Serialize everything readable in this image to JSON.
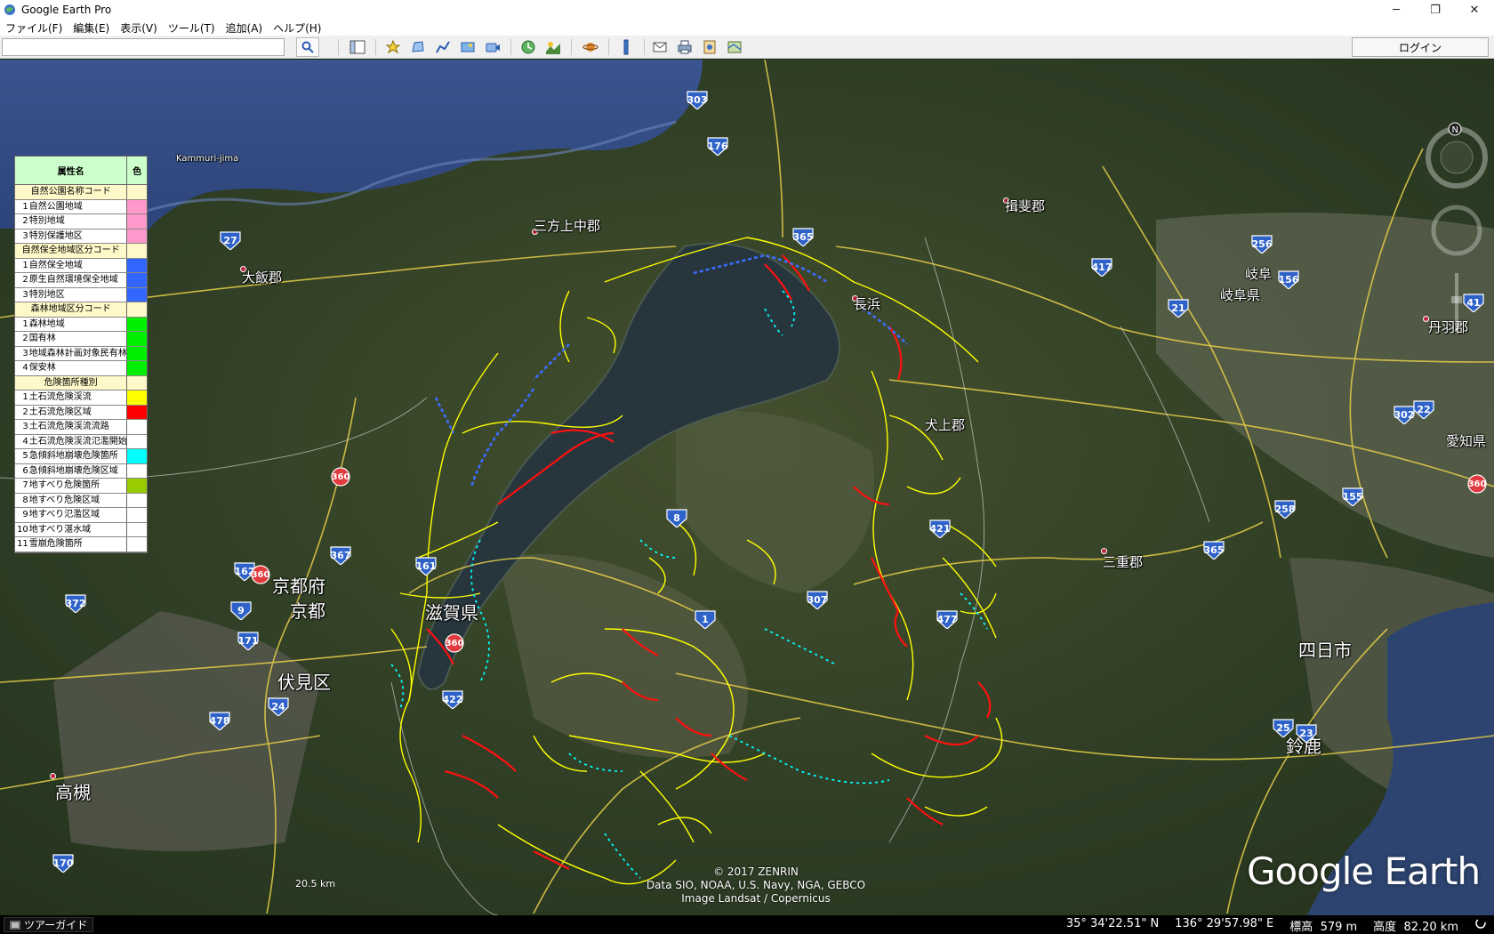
{
  "window": {
    "title": "Google Earth Pro",
    "controls": [
      "─",
      "❐",
      "✕"
    ]
  },
  "menu": [
    "ファイル(F)",
    "編集(E)",
    "表示(V)",
    "ツール(T)",
    "追加(A)",
    "ヘルプ(H)"
  ],
  "toolbar": {
    "search_value": "",
    "login_label": "ログイン"
  },
  "legend": {
    "header_name": "属性名",
    "header_color": "色",
    "categories": [
      {
        "title": "自然公園名称コード",
        "items": [
          {
            "num": "1",
            "label": "自然公園地域",
            "color": "#ff99cc"
          },
          {
            "num": "2",
            "label": "特別地域",
            "color": "#ff99cc"
          },
          {
            "num": "3",
            "label": "特別保護地区",
            "color": "#ff99cc"
          }
        ]
      },
      {
        "title": "自然保全地域区分コード",
        "items": [
          {
            "num": "1",
            "label": "自然保全地域",
            "color": "#3366ff"
          },
          {
            "num": "2",
            "label": "原生自然環境保全地域",
            "color": "#3366ff"
          },
          {
            "num": "3",
            "label": "特別地区",
            "color": "#3366ff"
          }
        ]
      },
      {
        "title": "森林地域区分コード",
        "items": [
          {
            "num": "1",
            "label": "森林地域",
            "color": "#00ee00"
          },
          {
            "num": "2",
            "label": "国有林",
            "color": "#00ee00"
          },
          {
            "num": "3",
            "label": "地域森林計画対象民有林",
            "color": "#00ee00"
          },
          {
            "num": "4",
            "label": "保安林",
            "color": "#00ee00"
          }
        ]
      },
      {
        "title": "危険箇所種別",
        "items": [
          {
            "num": "1",
            "label": "土石流危険渓流",
            "color": "#ffff00"
          },
          {
            "num": "2",
            "label": "土石流危険区域",
            "color": "#ff0000"
          },
          {
            "num": "3",
            "label": "土石流危険渓流流路",
            "color": "#ffffff"
          },
          {
            "num": "4",
            "label": "土石流危険渓流氾濫開始点",
            "color": "#ffffff"
          },
          {
            "num": "5",
            "label": "急傾斜地崩壊危険箇所",
            "color": "#00ffff"
          },
          {
            "num": "6",
            "label": "急傾斜地崩壊危険区域",
            "color": "#ffffff"
          },
          {
            "num": "7",
            "label": "地すべり危険箇所",
            "color": "#99cc00"
          },
          {
            "num": "8",
            "label": "地すべり危険区域",
            "color": "#ffffff"
          },
          {
            "num": "9",
            "label": "地すべり氾濫区域",
            "color": "#ffffff"
          },
          {
            "num": "10",
            "label": "地すべり湛水域",
            "color": "#ffffff"
          },
          {
            "num": "11",
            "label": "雪崩危険箇所",
            "color": "#ffffff"
          }
        ]
      }
    ]
  },
  "places": [
    {
      "name": "Kammuri-jima",
      "size": "small"
    },
    {
      "name": "三方上中郡",
      "size": "normal"
    },
    {
      "name": "大飯郡",
      "size": "normal"
    },
    {
      "name": "揖斐郡",
      "size": "normal"
    },
    {
      "name": "長浜",
      "size": "normal"
    },
    {
      "name": "岐阜",
      "size": "normal"
    },
    {
      "name": "岐阜県",
      "size": "normal"
    },
    {
      "name": "丹羽郡",
      "size": "normal"
    },
    {
      "name": "犬上郡",
      "size": "normal"
    },
    {
      "name": "愛知県",
      "size": "normal"
    },
    {
      "name": "京都府",
      "size": "big"
    },
    {
      "name": "京都",
      "size": "big"
    },
    {
      "name": "滋賀県",
      "size": "big"
    },
    {
      "name": "伏見区",
      "size": "big"
    },
    {
      "name": "三重郡",
      "size": "normal"
    },
    {
      "name": "四日市",
      "size": "big"
    },
    {
      "name": "鈴鹿",
      "size": "big"
    },
    {
      "name": "高槻",
      "size": "big"
    }
  ],
  "routes": [
    {
      "num": "303",
      "color": "blue"
    },
    {
      "num": "176",
      "color": "blue"
    },
    {
      "num": "365",
      "color": "blue"
    },
    {
      "num": "27",
      "color": "blue"
    },
    {
      "num": "417",
      "color": "blue"
    },
    {
      "num": "256",
      "color": "blue"
    },
    {
      "num": "21",
      "color": "blue"
    },
    {
      "num": "156",
      "color": "blue"
    },
    {
      "num": "41",
      "color": "blue"
    },
    {
      "num": "302",
      "color": "blue"
    },
    {
      "num": "22",
      "color": "blue"
    },
    {
      "num": "360",
      "color": "red"
    },
    {
      "num": "8",
      "color": "blue"
    },
    {
      "num": "421",
      "color": "blue"
    },
    {
      "num": "258",
      "color": "blue"
    },
    {
      "num": "155",
      "color": "blue"
    },
    {
      "num": "367",
      "color": "blue"
    },
    {
      "num": "161",
      "color": "blue"
    },
    {
      "num": "162",
      "color": "blue"
    },
    {
      "num": "360",
      "color": "red"
    },
    {
      "num": "372",
      "color": "blue"
    },
    {
      "num": "9",
      "color": "blue"
    },
    {
      "num": "307",
      "color": "blue"
    },
    {
      "num": "1",
      "color": "blue"
    },
    {
      "num": "477",
      "color": "blue"
    },
    {
      "num": "365",
      "color": "blue"
    },
    {
      "num": "171",
      "color": "blue"
    },
    {
      "num": "24",
      "color": "blue"
    },
    {
      "num": "360",
      "color": "red"
    },
    {
      "num": "422",
      "color": "blue"
    },
    {
      "num": "478",
      "color": "blue"
    },
    {
      "num": "25",
      "color": "blue"
    },
    {
      "num": "23",
      "color": "blue"
    },
    {
      "num": "170",
      "color": "blue"
    },
    {
      "num": "360",
      "color": "red"
    }
  ],
  "scale": {
    "label": "20.5 km"
  },
  "attribution": {
    "line1": "© 2017 ZENRIN",
    "line2": "Data SIO, NOAA, U.S. Navy, NGA, GEBCO",
    "line3": "Image Landsat / Copernicus"
  },
  "logo": "Google Earth",
  "status": {
    "tour_label": "ツアーガイド",
    "lat": "35° 34'22.51\" N",
    "lon": "136° 29'57.98\" E",
    "elev_label": "標高",
    "elev_value": "579 m",
    "alt_label": "高度",
    "alt_value": "82.20 km"
  }
}
